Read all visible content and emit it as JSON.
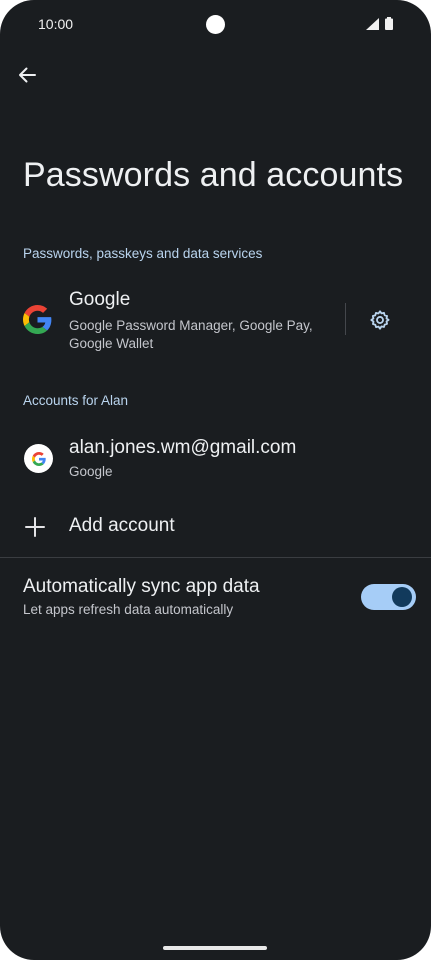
{
  "status_bar": {
    "time": "10:00"
  },
  "page": {
    "title": "Passwords and accounts"
  },
  "password_services": {
    "header": "Passwords, passkeys and data services",
    "provider": {
      "name": "Google",
      "description": "Google Password Manager, Google Pay, Google Wallet",
      "icon": "google-logo-icon",
      "settings_icon": "gear-icon"
    }
  },
  "accounts": {
    "header": "Accounts for Alan",
    "items": [
      {
        "email": "alan.jones.wm@gmail.com",
        "provider": "Google",
        "icon": "google-logo-icon"
      }
    ],
    "add_label": "Add account",
    "add_icon": "plus-icon"
  },
  "sync": {
    "title": "Automatically sync app data",
    "subtitle": "Let apps refresh data automatically",
    "enabled": true
  },
  "colors": {
    "background": "#1a1d20",
    "section_header": "#b9d4ee",
    "toggle_track": "#a6cdf7",
    "toggle_thumb": "#123a5c"
  }
}
